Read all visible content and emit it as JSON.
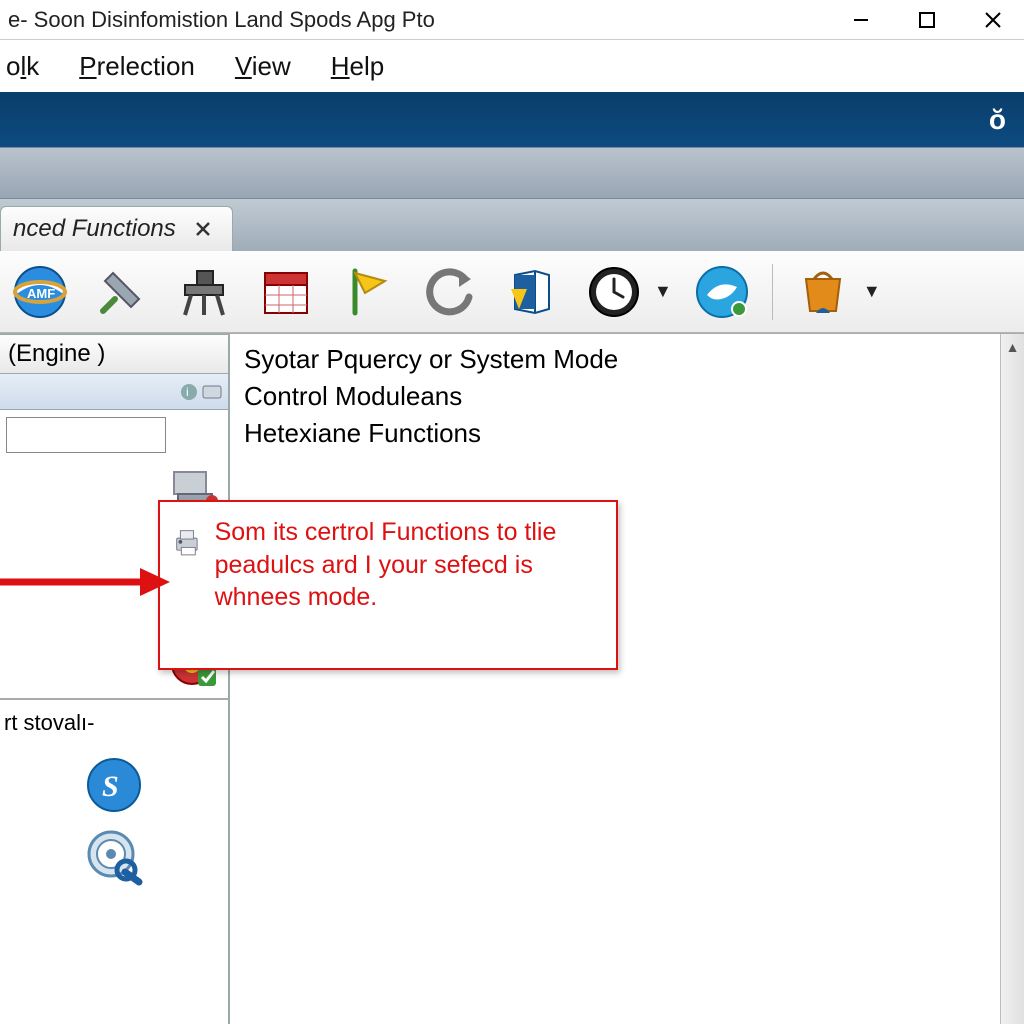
{
  "window": {
    "title": "e- Soon Disinfomistion Land Spods Apg Pto"
  },
  "menu": {
    "item1_pre": "o",
    "item1_ul": "l",
    "item1_post": "k",
    "item2_pre": "",
    "item2_ul": "P",
    "item2_post": "relection",
    "item3_pre": "",
    "item3_ul": "V",
    "item3_post": "iew",
    "item4_pre": "",
    "item4_ul": "H",
    "item4_post": "elp"
  },
  "tab": {
    "label": "nced Functions"
  },
  "sidebar": {
    "header": "(Engine )",
    "section2": "rt stovalı-"
  },
  "content": {
    "line1": "Syotar Pquercy or System Mode",
    "line2": "Control Moduleans",
    "line3": "Hetexiane Functions"
  },
  "callout": {
    "text": "Som its certrol Functions to tlie peadulcs ard I your sefecd is whnees mode."
  }
}
